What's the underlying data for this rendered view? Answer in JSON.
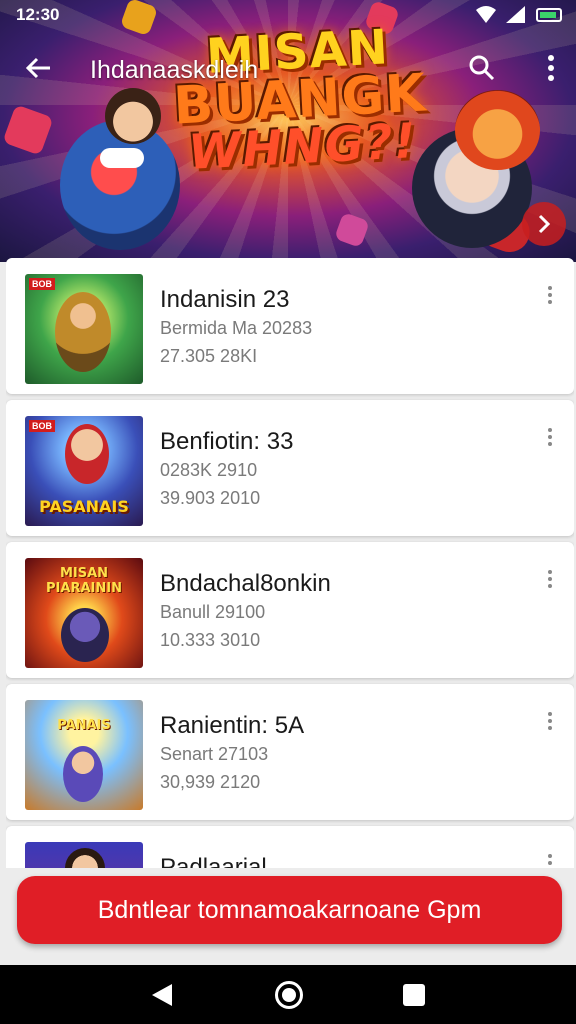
{
  "status_bar": {
    "time": "12:30"
  },
  "app_bar": {
    "title": "Ihdanaaskdleih"
  },
  "hero": {
    "title_line1": "MISAN",
    "title_line2": "BUANGK",
    "title_line3": "WHNG?!"
  },
  "list": [
    {
      "title": "Indanisin 23",
      "line2": "Bermida Ma 20283",
      "line3": "27.305 28KI",
      "thumb_caption": "",
      "thumb_top": "",
      "thumb_badge": "BOB"
    },
    {
      "title": "Benfiotin: 33",
      "line2": "0283K 2910",
      "line3": "39.903 2010",
      "thumb_caption": "PASANAIS",
      "thumb_top": "",
      "thumb_badge": "BOB"
    },
    {
      "title": "Bndachal8onkin",
      "line2": "Banull 29100",
      "line3": "10.333 3010",
      "thumb_caption": "",
      "thumb_top": "MISAN PIARAININ",
      "thumb_badge": ""
    },
    {
      "title": "Ranientin: 5A",
      "line2": "Senart 27103",
      "line3": "30,939 2120",
      "thumb_caption": "",
      "thumb_top": "PANAIS",
      "thumb_badge": ""
    },
    {
      "title": "Padlaarial",
      "line2": "",
      "line3": "",
      "thumb_caption": "",
      "thumb_top": "",
      "thumb_badge": ""
    }
  ],
  "cta": {
    "label": "Bdntlear tomnamoakarnoane Gpm"
  },
  "colors": {
    "accent": "#e01e26",
    "status_batt": "#3bd46a"
  }
}
